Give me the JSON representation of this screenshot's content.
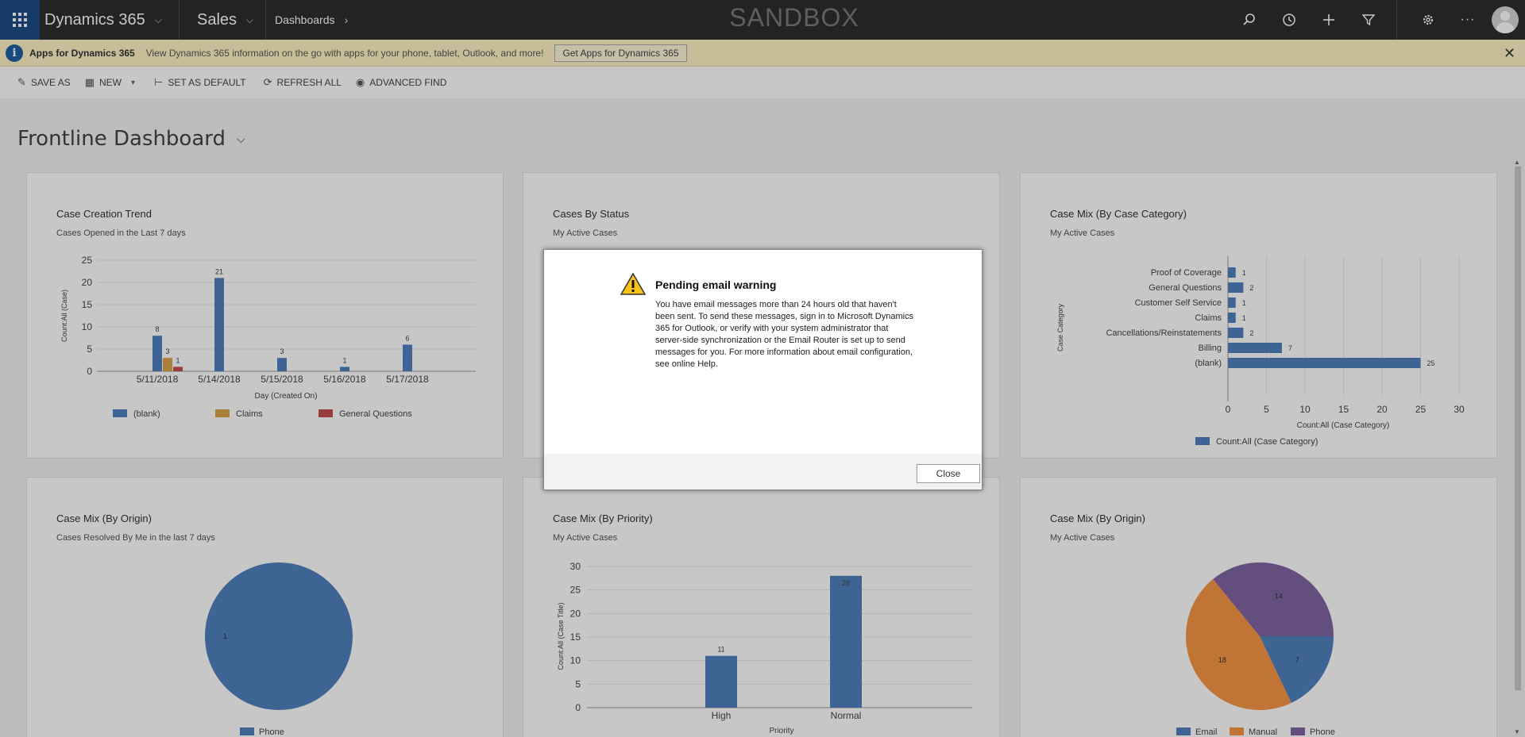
{
  "topnav": {
    "app_name": "Dynamics 365",
    "module": "Sales",
    "breadcrumb": "Dashboards",
    "environment_label": "SANDBOX",
    "icons": [
      "search-icon",
      "history-icon",
      "plus-icon",
      "filter-icon",
      "gear-icon",
      "more-icon"
    ]
  },
  "notification": {
    "title": "Apps for Dynamics 365",
    "message": "View Dynamics 365 information on the go with apps for your phone, tablet, Outlook, and more!",
    "button": "Get Apps for Dynamics 365"
  },
  "commands": {
    "save_as": "SAVE AS",
    "new": "NEW",
    "set_default": "SET AS DEFAULT",
    "refresh_all": "REFRESH ALL",
    "advanced_find": "ADVANCED FIND"
  },
  "dashboard": {
    "title": "Frontline Dashboard"
  },
  "panels": {
    "p1": {
      "title": "Case Creation Trend",
      "subtitle": "Cases Opened in the Last 7 days"
    },
    "p2": {
      "title": "Cases By Status",
      "subtitle": "My Active Cases"
    },
    "p3": {
      "title": "Case Mix (By Case Category)",
      "subtitle": "My Active Cases"
    },
    "p4": {
      "title": "Case Mix (By Origin)",
      "subtitle": "Cases Resolved By Me in the last 7 days"
    },
    "p5": {
      "title": "Case Mix (By Priority)",
      "subtitle": "My Active Cases"
    },
    "p6": {
      "title": "Case Mix (By Origin)",
      "subtitle": "My Active Cases"
    }
  },
  "colors": {
    "blue": "#4f81bd",
    "orange": "#f79646",
    "red": "#c0504d",
    "purple": "#8064a2",
    "tan": "#dca24b"
  },
  "chart_data": [
    {
      "type": "bar",
      "title": "Case Creation Trend",
      "xlabel": "Day (Created On)",
      "ylabel": "Count:All (Case)",
      "ylim": [
        0,
        25
      ],
      "yticks": [
        0,
        5,
        10,
        15,
        20,
        25
      ],
      "categories": [
        "5/11/2018",
        "5/14/2018",
        "5/15/2018",
        "5/16/2018",
        "5/17/2018"
      ],
      "series": [
        {
          "name": "(blank)",
          "values": [
            8,
            21,
            3,
            1,
            6
          ]
        },
        {
          "name": "Claims",
          "values": [
            3,
            null,
            null,
            null,
            null
          ]
        },
        {
          "name": "General Questions",
          "values": [
            1,
            null,
            null,
            null,
            null
          ]
        }
      ],
      "legend": "bottom",
      "grid": true
    },
    {
      "type": "bar",
      "orientation": "horizontal",
      "title": "Case Mix (By Case Category)",
      "xlabel": "Count:All (Case Category)",
      "ylabel": "Case Category",
      "xlim": [
        0,
        30
      ],
      "xticks": [
        0,
        5,
        10,
        15,
        20,
        25,
        30
      ],
      "categories": [
        "Proof of Coverage",
        "General Questions",
        "Customer Self Service",
        "Claims",
        "Cancellations/Reinstatements",
        "Billing",
        "(blank)"
      ],
      "series": [
        {
          "name": "Count:All (Case Category)",
          "values": [
            1,
            2,
            1,
            1,
            2,
            7,
            25
          ]
        }
      ],
      "legend": "bottom",
      "grid": true
    },
    {
      "type": "pie",
      "title": "Case Mix (By Origin)",
      "categories": [
        "Phone"
      ],
      "values": [
        1
      ],
      "legend": "bottom"
    },
    {
      "type": "bar",
      "title": "Case Mix (By Priority)",
      "xlabel": "Priority",
      "ylabel": "Count:All (Case Title)",
      "ylim": [
        0,
        30
      ],
      "yticks": [
        0,
        5,
        10,
        15,
        20,
        25,
        30
      ],
      "categories": [
        "High",
        "Normal"
      ],
      "values": [
        11,
        28
      ],
      "grid": true
    },
    {
      "type": "pie",
      "title": "Case Mix (By Origin)",
      "categories": [
        "Email",
        "Manual",
        "Phone"
      ],
      "values": [
        7,
        18,
        14
      ],
      "legend": "bottom"
    }
  ],
  "dialog": {
    "title": "Pending email warning",
    "body": "You have email messages more than 24 hours old that haven't been sent. To send these messages, sign in to Microsoft Dynamics 365 for Outlook, or verify with your system administrator that server-side synchronization or the Email Router is set up to send messages for you. For more information about email configuration, see online Help.",
    "close_button": "Close"
  }
}
